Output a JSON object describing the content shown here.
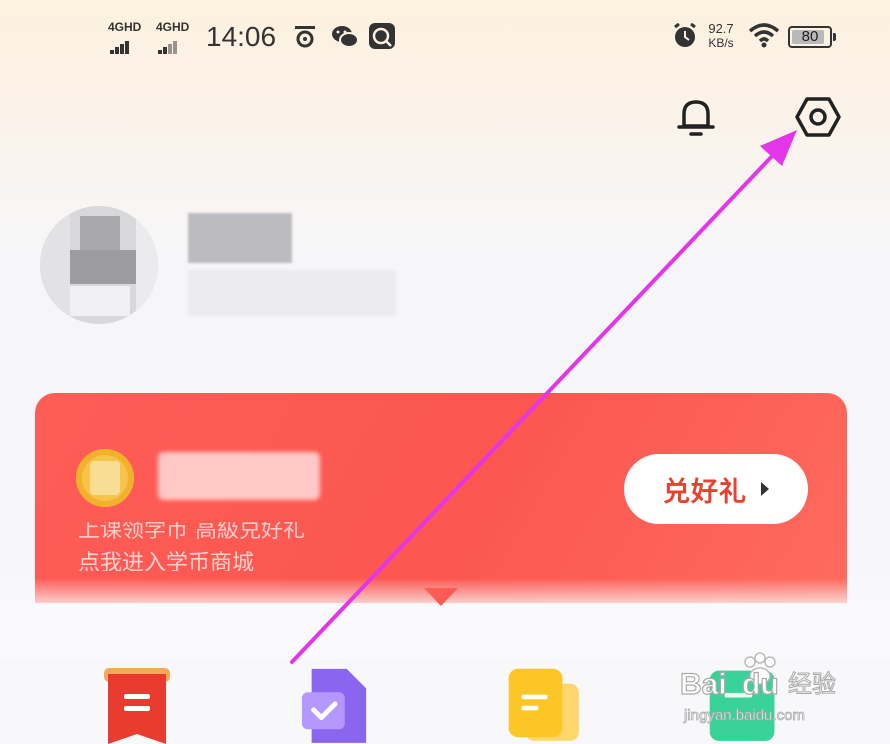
{
  "status_bar": {
    "network_1": "4GHD",
    "network_2": "4GHD",
    "time": "14:06",
    "speed_value": "92.7",
    "speed_unit": "KB/s",
    "battery": "80"
  },
  "header": {
    "bell_icon": "bell-icon",
    "settings_icon": "settings-hexagon-icon"
  },
  "points_card": {
    "redeem_label": "兑好礼",
    "desc_line1": "上课领学币 高級兑好礼",
    "desc_line2": "点我进入学币商城",
    "accent": "#fb5750"
  },
  "annotation": {
    "arrow_color": "#e336e8"
  },
  "watermark": {
    "brand": "Baidu经验",
    "url": "jingyan.baidu.com"
  },
  "grid_icons": [
    "red-document-icon",
    "purple-check-document-icon",
    "yellow-document-icon",
    "green-document-icon"
  ]
}
